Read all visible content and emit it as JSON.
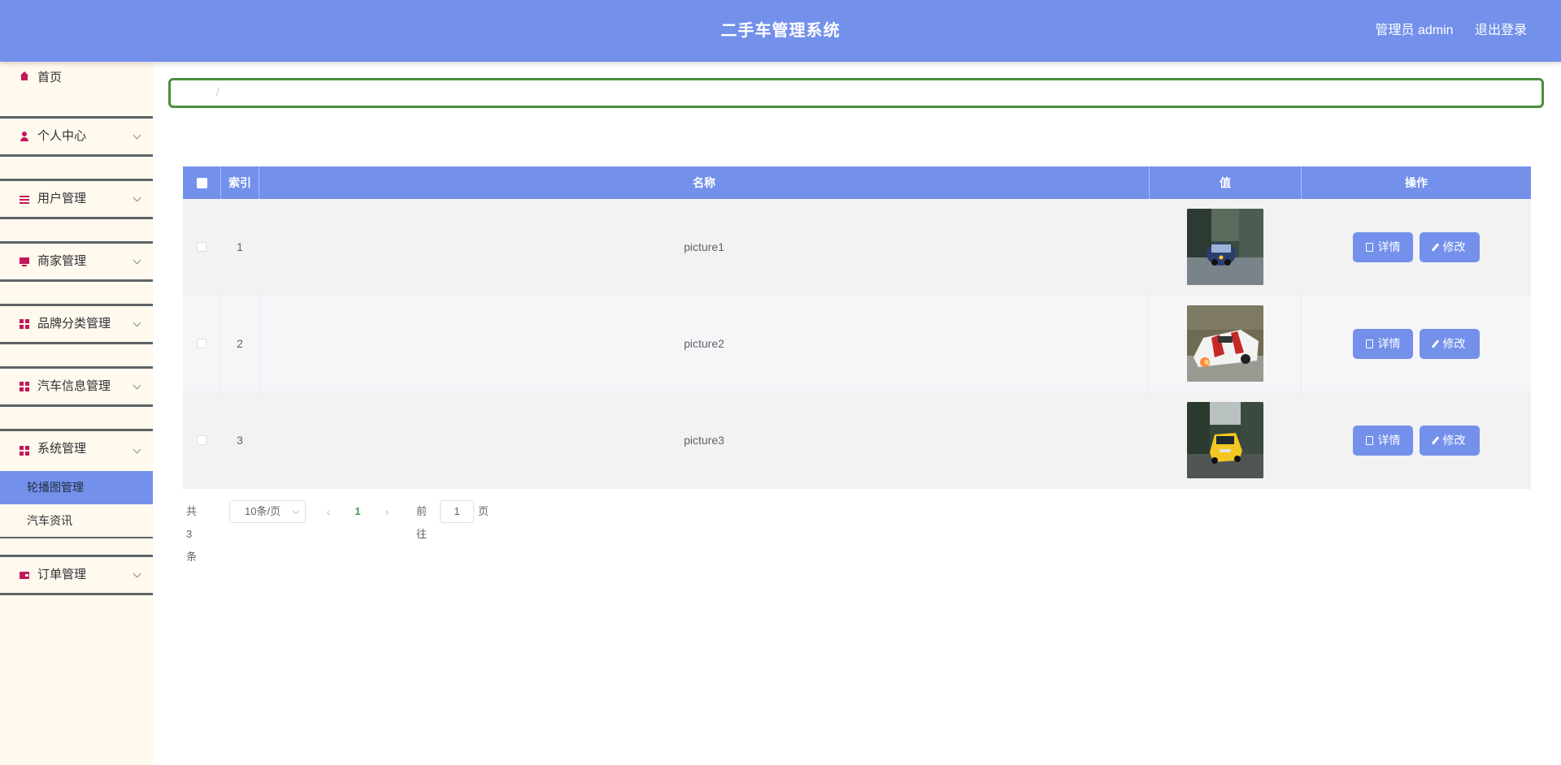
{
  "header": {
    "title": "二手车管理系统",
    "user_label": "管理员 admin",
    "logout_label": "退出登录"
  },
  "sidebar": {
    "home_label": "首页",
    "menus": [
      {
        "label": "个人中心",
        "icon": "user-icon"
      },
      {
        "label": "用户管理",
        "icon": "sliders-icon"
      },
      {
        "label": "商家管理",
        "icon": "monitor-icon"
      },
      {
        "label": "品牌分类管理",
        "icon": "grid-icon"
      },
      {
        "label": "汽车信息管理",
        "icon": "grid-icon"
      },
      {
        "label": "系统管理",
        "icon": "grid-icon"
      },
      {
        "label": "订单管理",
        "icon": "wallet-icon"
      }
    ],
    "submenu": [
      {
        "label": "轮播图管理",
        "active": true
      },
      {
        "label": "汽车资讯",
        "active": false
      }
    ]
  },
  "breadcrumb": {
    "separator": "/"
  },
  "table": {
    "headers": {
      "index": "索引",
      "name": "名称",
      "value": "值",
      "actions": "操作"
    },
    "rows": [
      {
        "index": "1",
        "name": "picture1",
        "image": "race car on track, dark blue, motion blur"
      },
      {
        "index": "2",
        "name": "picture2",
        "image": "white race car with red livery, cornering"
      },
      {
        "index": "3",
        "name": "picture3",
        "image": "yellow race car on forest road"
      }
    ],
    "detail_label": "详情",
    "edit_label": "修改"
  },
  "pagination": {
    "total_text": "共 3 条",
    "page_size": "10条/页",
    "current_page": "1",
    "goto_label": "前往",
    "goto_value": "1",
    "page_suffix": "页"
  },
  "colors": {
    "header_bg": "#7390eb",
    "sidebar_bg": "#fff9ee",
    "accent_icon": "#c2185b",
    "breadcrumb_border": "#4a8f3c"
  }
}
